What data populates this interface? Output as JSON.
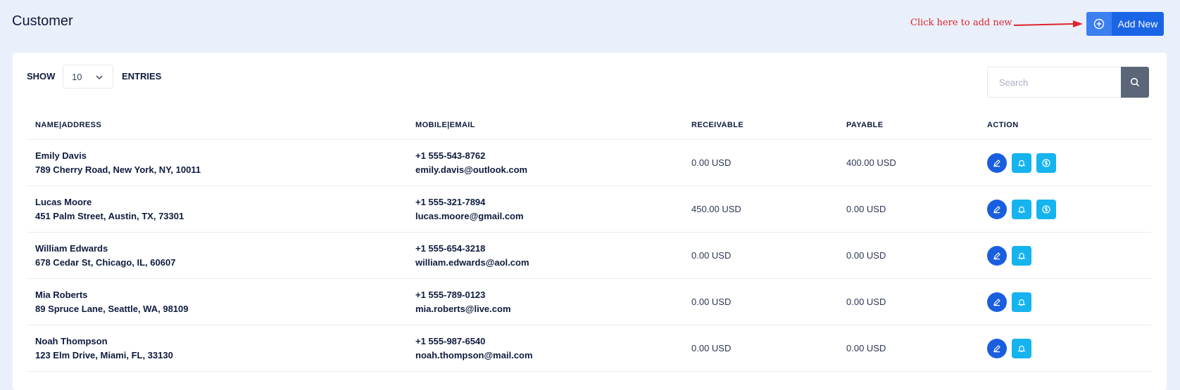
{
  "page": {
    "title": "Customer"
  },
  "annotation": {
    "text": "Click here to add new"
  },
  "header": {
    "add_new_label": "Add New"
  },
  "controls": {
    "show_label": "SHOW",
    "entries_label": "ENTRIES",
    "entries_value": "10",
    "search_placeholder": "Search"
  },
  "table": {
    "headers": [
      "NAME|ADDRESS",
      "MOBILE|EMAIL",
      "RECEIVABLE",
      "PAYABLE",
      "ACTION"
    ],
    "rows": [
      {
        "name": "Emily Davis",
        "address": "789 Cherry Road, New York, NY, 10011",
        "mobile": "+1 555-543-8762",
        "email": "emily.davis@outlook.com",
        "receivable": "0.00 USD",
        "payable": "400.00 USD",
        "actions": [
          "edit-icon",
          "bell-icon",
          "dollar-icon"
        ]
      },
      {
        "name": "Lucas Moore",
        "address": "451 Palm Street, Austin, TX, 73301",
        "mobile": "+1 555-321-7894",
        "email": "lucas.moore@gmail.com",
        "receivable": "450.00 USD",
        "payable": "0.00 USD",
        "actions": [
          "edit-icon",
          "bell-icon",
          "dollar-icon"
        ]
      },
      {
        "name": "William Edwards",
        "address": "678 Cedar St, Chicago, IL, 60607",
        "mobile": "+1 555-654-3218",
        "email": "william.edwards@aol.com",
        "receivable": "0.00 USD",
        "payable": "0.00 USD",
        "actions": [
          "edit-icon",
          "bell-icon"
        ]
      },
      {
        "name": "Mia Roberts",
        "address": "89 Spruce Lane, Seattle, WA, 98109",
        "mobile": "+1 555-789-0123",
        "email": "mia.roberts@live.com",
        "receivable": "0.00 USD",
        "payable": "0.00 USD",
        "actions": [
          "edit-icon",
          "bell-icon"
        ]
      },
      {
        "name": "Noah Thompson",
        "address": "123 Elm Drive, Miami, FL, 33130",
        "mobile": "+1 555-987-6540",
        "email": "noah.thompson@mail.com",
        "receivable": "0.00 USD",
        "payable": "0.00 USD",
        "actions": [
          "edit-icon",
          "bell-icon"
        ]
      }
    ]
  },
  "colors": {
    "background": "#eaf0fb",
    "primary": "#1a65e6",
    "accent_cyan": "#16b4ef",
    "annotation_red": "#e0242a"
  }
}
